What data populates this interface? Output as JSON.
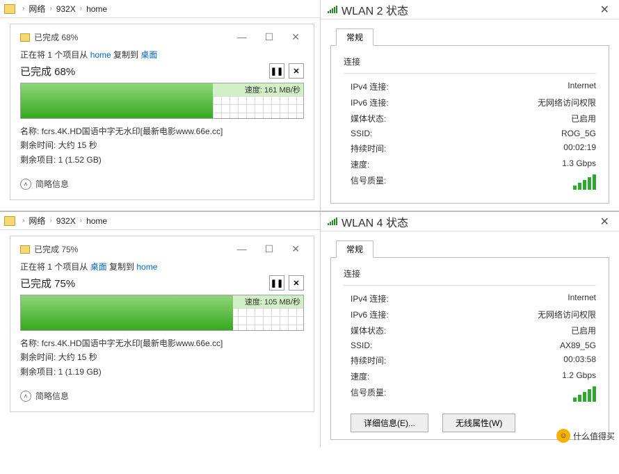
{
  "breadcrumb": {
    "items": [
      "网络",
      "932X",
      "home"
    ]
  },
  "copy1": {
    "window_title": "已完成 68%",
    "desc_prefix": "正在将 1 个项目从 ",
    "src": "home",
    "desc_mid": " 复制到 ",
    "dst": "桌面",
    "status_text": "已完成 68%",
    "percent": 68,
    "speed": "速度: 161 MB/秒",
    "name_label": "名称: ",
    "name_value": "fcrs.4K.HD国语中字无水印[最新电影www.66e.cc]",
    "remain_time_label": "剩余时间: ",
    "remain_time_value": "大约 15 秒",
    "remain_item_label": "剩余项目: ",
    "remain_item_value": "1 (1.52 GB)",
    "more_info": "简略信息"
  },
  "copy2": {
    "window_title": "已完成 75%",
    "desc_prefix": "正在将 1 个项目从 ",
    "src": "桌面",
    "desc_mid": " 复制到 ",
    "dst": "home",
    "status_text": "已完成 75%",
    "percent": 75,
    "speed": "速度: 105 MB/秒",
    "name_label": "名称: ",
    "name_value": "fcrs.4K.HD国语中字无水印[最新电影www.66e.cc]",
    "remain_time_label": "剩余时间: ",
    "remain_time_value": "大约 15 秒",
    "remain_item_label": "剩余项目: ",
    "remain_item_value": "1 (1.19 GB)",
    "more_info": "简略信息"
  },
  "wlan1": {
    "title": "WLAN 2 状态",
    "tab": "常规",
    "group_conn": "连接",
    "rows": [
      {
        "k": "IPv4 连接:",
        "v": "Internet"
      },
      {
        "k": "IPv6 连接:",
        "v": "无网络访问权限"
      },
      {
        "k": "媒体状态:",
        "v": "已启用"
      },
      {
        "k": "SSID:",
        "v": "ROG_5G"
      },
      {
        "k": "持续时间:",
        "v": "00:02:19"
      },
      {
        "k": "速度:",
        "v": "1.3 Gbps"
      }
    ],
    "signal_label": "信号质量:"
  },
  "wlan2": {
    "title": "WLAN 4 状态",
    "tab": "常规",
    "group_conn": "连接",
    "rows": [
      {
        "k": "IPv4 连接:",
        "v": "Internet"
      },
      {
        "k": "IPv6 连接:",
        "v": "无网络访问权限"
      },
      {
        "k": "媒体状态:",
        "v": "已启用"
      },
      {
        "k": "SSID:",
        "v": "AX89_5G"
      },
      {
        "k": "持续时间:",
        "v": "00:03:58"
      },
      {
        "k": "速度:",
        "v": "1.2 Gbps"
      }
    ],
    "signal_label": "信号质量:",
    "btn_details": "详细信息(E)...",
    "btn_wireless": "无线属性(W)"
  },
  "watermark": "什么值得买"
}
